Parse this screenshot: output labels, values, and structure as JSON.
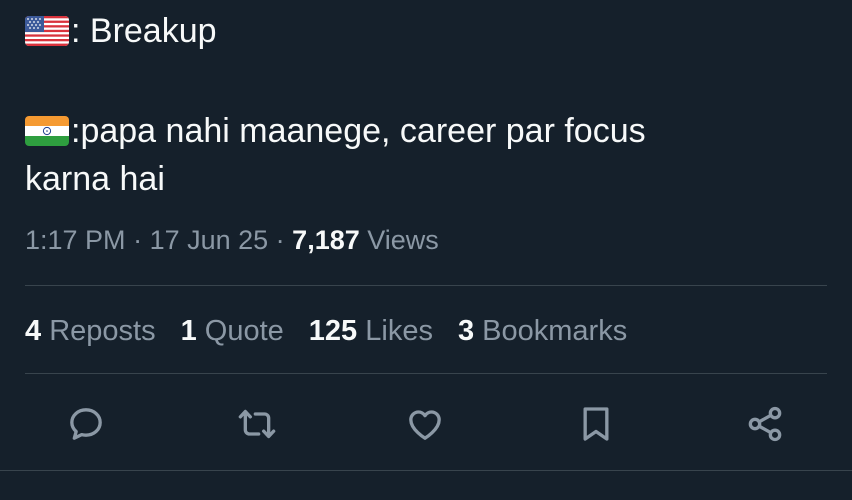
{
  "tweet": {
    "line1_text": ": Breakup",
    "line2_text": ":papa nahi maanege, career par focus",
    "line3_text": "karna hai",
    "line1_flag": "us-flag-icon",
    "line2_flag": "india-flag-icon"
  },
  "meta": {
    "time": "1:17 PM",
    "sep1": " · ",
    "date": "17 Jun 25",
    "sep2": " · ",
    "views_count": "7,187",
    "views_label": " Views"
  },
  "stats": {
    "reposts_count": "4",
    "reposts_label": " Reposts",
    "quotes_count": "1",
    "quotes_label": " Quote",
    "likes_count": "125",
    "likes_label": " Likes",
    "bookmarks_count": "3",
    "bookmarks_label": " Bookmarks"
  },
  "actions": {
    "reply_icon": "reply-icon",
    "repost_icon": "repost-icon",
    "like_icon": "heart-icon",
    "bookmark_icon": "bookmark-icon",
    "share_icon": "share-icon"
  },
  "colors": {
    "background": "#15202b",
    "text": "#f7f9f9",
    "muted": "#8b98a5",
    "divider": "#38444d"
  }
}
